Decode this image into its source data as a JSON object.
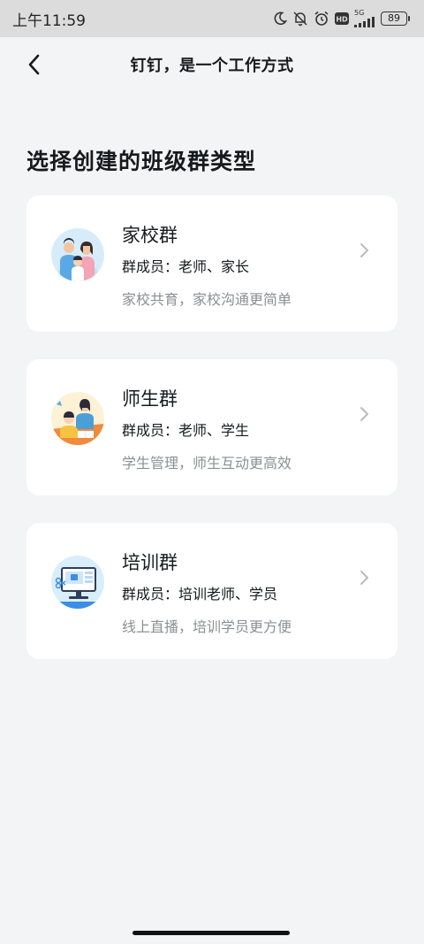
{
  "status_bar": {
    "time": "上午11:59",
    "network": "5G",
    "hd": "HD",
    "battery": "89"
  },
  "nav": {
    "title": "钉钉，是一个工作方式"
  },
  "page": {
    "title": "选择创建的班级群类型"
  },
  "group_types": [
    {
      "title": "家校群",
      "members": "群成员：老师、家长",
      "description": "家校共育，家校沟通更简单",
      "icon": "family-illustration-icon"
    },
    {
      "title": "师生群",
      "members": "群成员：老师、学生",
      "description": "学生管理，师生互动更高效",
      "icon": "teacher-student-illustration-icon"
    },
    {
      "title": "培训群",
      "members": "群成员：培训老师、学员",
      "description": "线上直播，培训学员更方便",
      "icon": "monitor-training-illustration-icon"
    }
  ],
  "colors": {
    "background": "#f3f4f6",
    "card": "#ffffff",
    "text_primary": "#171a1d",
    "text_secondary": "#8c8f94",
    "chevron": "#b8bbbf"
  }
}
